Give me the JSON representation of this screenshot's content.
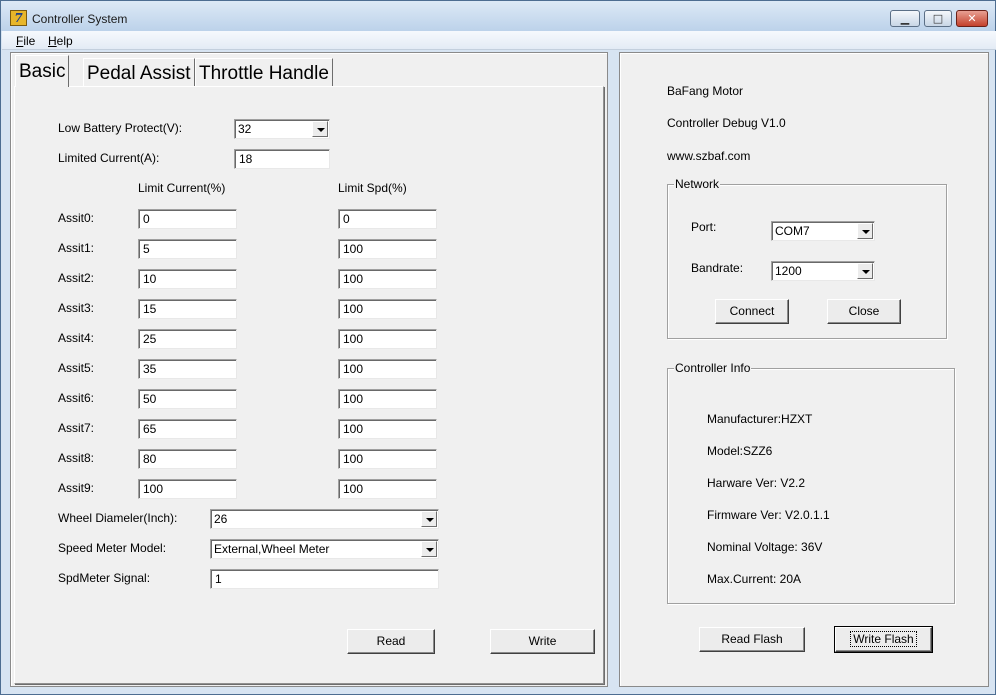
{
  "window": {
    "title": "Controller System"
  },
  "menu": {
    "file_u": "F",
    "file_rest": "ile",
    "help_u": "H",
    "help_rest": "elp"
  },
  "tabs": [
    "Basic",
    "Pedal Assist",
    "Throttle Handle"
  ],
  "basic": {
    "low_battery_label": "Low Battery Protect(V):",
    "low_battery_value": "32",
    "limited_current_label": "Limited Current(A):",
    "limited_current_value": "18",
    "col_limit_current": "Limit Current(%)",
    "col_limit_spd": "Limit Spd(%)",
    "assist_rows": [
      {
        "label": "Assit0:",
        "current": "0",
        "speed": "0"
      },
      {
        "label": "Assit1:",
        "current": "5",
        "speed": "100"
      },
      {
        "label": "Assit2:",
        "current": "10",
        "speed": "100"
      },
      {
        "label": "Assit3:",
        "current": "15",
        "speed": "100"
      },
      {
        "label": "Assit4:",
        "current": "25",
        "speed": "100"
      },
      {
        "label": "Assit5:",
        "current": "35",
        "speed": "100"
      },
      {
        "label": "Assit6:",
        "current": "50",
        "speed": "100"
      },
      {
        "label": "Assit7:",
        "current": "65",
        "speed": "100"
      },
      {
        "label": "Assit8:",
        "current": "80",
        "speed": "100"
      },
      {
        "label": "Assit9:",
        "current": "100",
        "speed": "100"
      }
    ],
    "wheel_diameter_label": "Wheel Diameler(Inch):",
    "wheel_diameter_value": "26",
    "speed_meter_model_label": "Speed Meter Model:",
    "speed_meter_model_value": "External,Wheel Meter",
    "spdmeter_signal_label": "SpdMeter Signal:",
    "spdmeter_signal_value": "1",
    "read_button": "Read",
    "write_button": "Write"
  },
  "info": {
    "brand": "BaFang Motor",
    "debug_version": "Controller Debug V1.0",
    "website": "www.szbaf.com"
  },
  "network": {
    "title": "Network",
    "port_label": "Port:",
    "port_value": "COM7",
    "baudrate_label": "Bandrate:",
    "baudrate_value": "1200",
    "connect_button": "Connect",
    "close_button": "Close"
  },
  "controller_info": {
    "title": "Controller Info",
    "manufacturer": "Manufacturer:HZXT",
    "model": "Model:SZZ6",
    "hardware_ver": "Harware Ver: V2.2",
    "firmware_ver": "Firmware Ver: V2.0.1.1",
    "nominal_voltage": "Nominal Voltage: 36V",
    "max_current": "Max.Current: 20A"
  },
  "flash": {
    "read_button": "Read Flash",
    "write_button": "Write Flash"
  }
}
